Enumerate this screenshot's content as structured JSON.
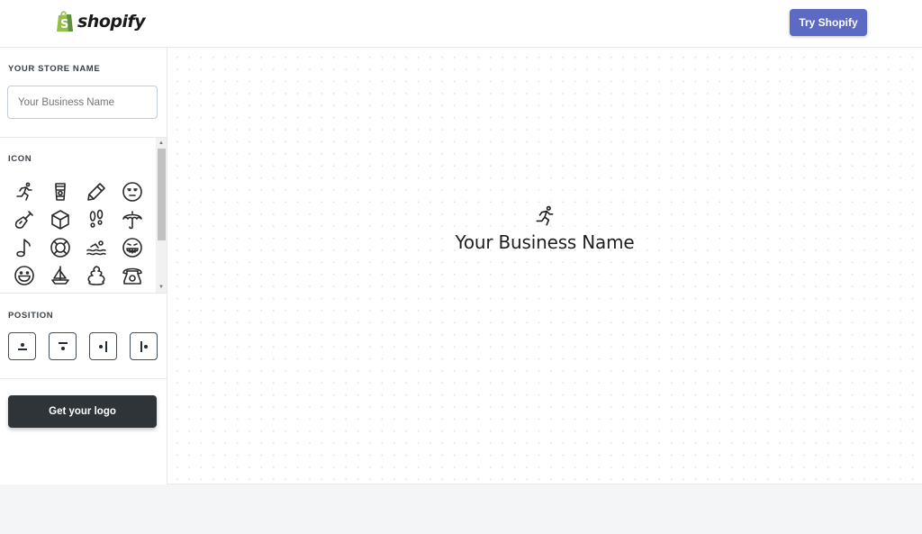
{
  "header": {
    "brand": "shopify",
    "brand_color": "#95bf47",
    "cta_label": "Try Shopify",
    "cta_color": "#5c6ac4"
  },
  "sidebar": {
    "store_name": {
      "title": "YOUR STORE NAME",
      "input_placeholder": "Your Business Name",
      "input_value": ""
    },
    "icon_section": {
      "title": "ICON",
      "icons": [
        {
          "name": "running-person",
          "selected": true
        },
        {
          "name": "coffee-cup"
        },
        {
          "name": "pencil"
        },
        {
          "name": "unamused-face"
        },
        {
          "name": "shovel"
        },
        {
          "name": "cube"
        },
        {
          "name": "footprints"
        },
        {
          "name": "umbrella"
        },
        {
          "name": "music-note"
        },
        {
          "name": "lifebuoy"
        },
        {
          "name": "swimmer"
        },
        {
          "name": "grinning-teeth-face"
        },
        {
          "name": "laughing-face"
        },
        {
          "name": "sailboat"
        },
        {
          "name": "poop"
        },
        {
          "name": "telephone"
        }
      ]
    },
    "position_section": {
      "title": "POSITION",
      "options": [
        {
          "name": "icon-above-small"
        },
        {
          "name": "icon-above"
        },
        {
          "name": "icon-left"
        },
        {
          "name": "icon-right"
        }
      ]
    },
    "get_logo_label": "Get your logo",
    "get_logo_color": "#2e3438"
  },
  "preview": {
    "icon": "running-person",
    "business_name": "Your Business Name"
  }
}
